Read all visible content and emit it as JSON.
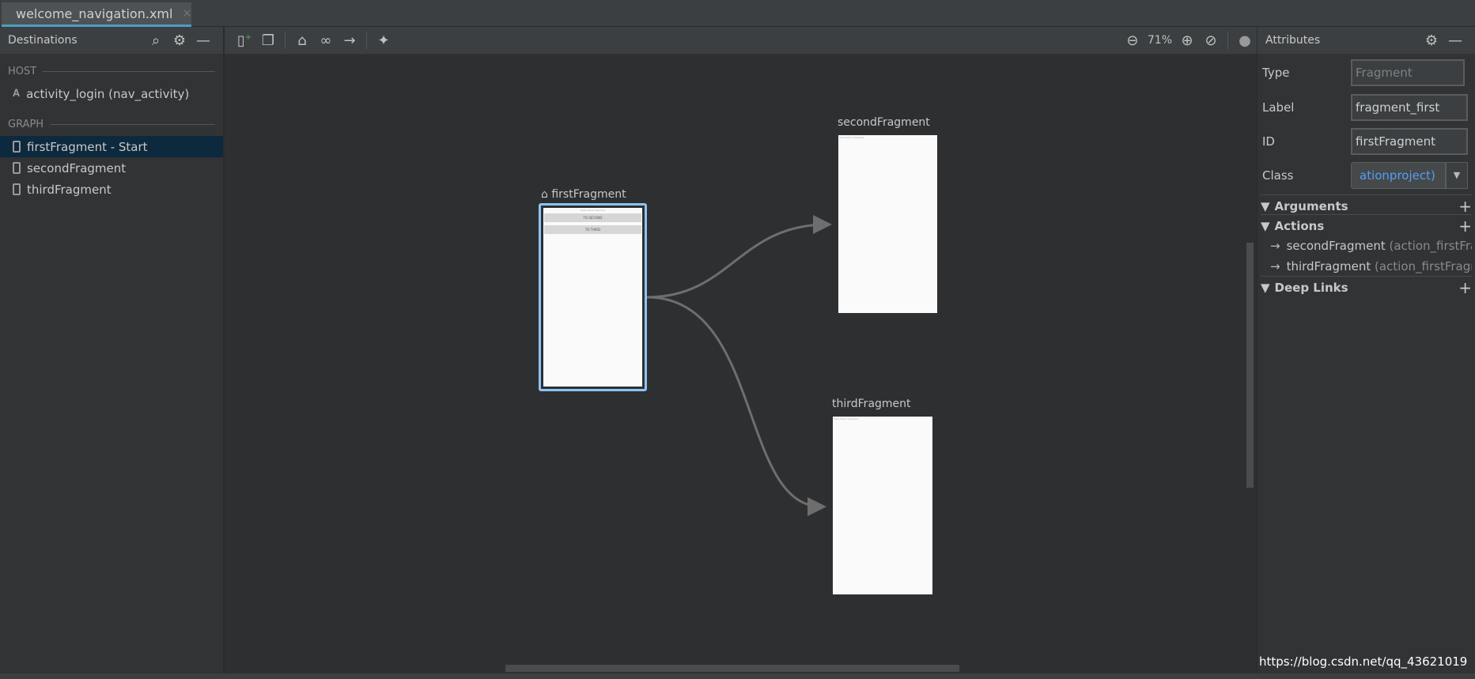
{
  "tab": {
    "title": "welcome_navigation.xml",
    "close": "×"
  },
  "destinations": {
    "title": "Destinations",
    "host_label": "HOST",
    "host_item": "activity_login (nav_activity)",
    "graph_label": "GRAPH",
    "items": [
      {
        "label": "firstFragment - Start",
        "selected": true
      },
      {
        "label": "secondFragment"
      },
      {
        "label": "thirdFragment"
      }
    ]
  },
  "toolbar": {
    "zoom": "71%"
  },
  "graph": {
    "nodes": [
      {
        "name": "firstFragment",
        "start": true,
        "text": "Hello blank fragment",
        "buttons": [
          "TO SECOND",
          "TO THIRD"
        ]
      },
      {
        "name": "secondFragment",
        "text": "Hello blank fragment"
      },
      {
        "name": "thirdFragment",
        "text": "Hello blank fragment"
      }
    ],
    "edges": [
      {
        "from": "firstFragment",
        "to": "secondFragment"
      },
      {
        "from": "firstFragment",
        "to": "thirdFragment"
      }
    ],
    "selection_color": "#8ec3f5"
  },
  "attributes": {
    "title": "Attributes",
    "type_label": "Type",
    "type_value": "Fragment",
    "label_label": "Label",
    "label_value": "fragment_first",
    "id_label": "ID",
    "id_value": "firstFragment",
    "class_label": "Class",
    "class_value": "ationproject)",
    "arguments": "Arguments",
    "actions": "Actions",
    "action_items": [
      {
        "dest": "secondFragment",
        "id": "(action_firstFra"
      },
      {
        "dest": "thirdFragment",
        "id": "(action_firstFragr"
      }
    ],
    "deep_links": "Deep Links"
  },
  "watermark": "https://blog.csdn.net/qq_43621019"
}
